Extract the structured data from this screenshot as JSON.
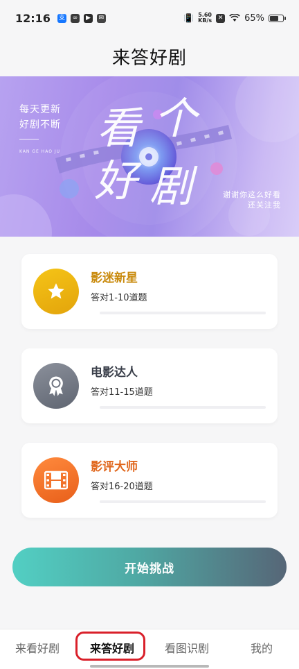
{
  "status_bar": {
    "time": "12:16",
    "net_speed_top": "5.60",
    "net_speed_bottom": "KB/s",
    "battery": "65%"
  },
  "header": {
    "title": "来答好剧"
  },
  "banner": {
    "slogan_line1": "每天更新",
    "slogan_line2": "好剧不断",
    "pinyin": "KAN GE HAO JU",
    "big_char_1": "看",
    "big_char_2": "个",
    "big_char_3": "好",
    "big_char_4": "剧",
    "thanks_line1": "谢谢你这么好看",
    "thanks_line2": "还关注我"
  },
  "levels": [
    {
      "title": "影迷新星",
      "subtitle": "答对1-10道题",
      "icon": "star-icon",
      "title_color": "#c98a0c",
      "badge_from": "#f5c417",
      "badge_to": "#e3a40b",
      "progress": 0
    },
    {
      "title": "电影达人",
      "subtitle": "答对11-15道题",
      "icon": "award-ribbon-icon",
      "title_color": "#3a3f4a",
      "badge_from": "#8b909b",
      "badge_to": "#5f6571",
      "progress": 0
    },
    {
      "title": "影评大师",
      "subtitle": "答对16-20道题",
      "icon": "film-strip-icon",
      "title_color": "#e0661c",
      "badge_from": "#ff8a3d",
      "badge_to": "#e85f1a",
      "progress": 0
    }
  ],
  "start_button": {
    "label": "开始挑战"
  },
  "tabs": [
    {
      "label": "来看好剧",
      "active": false
    },
    {
      "label": "来答好剧",
      "active": true
    },
    {
      "label": "看图识剧",
      "active": false
    },
    {
      "label": "我的",
      "active": false
    }
  ]
}
